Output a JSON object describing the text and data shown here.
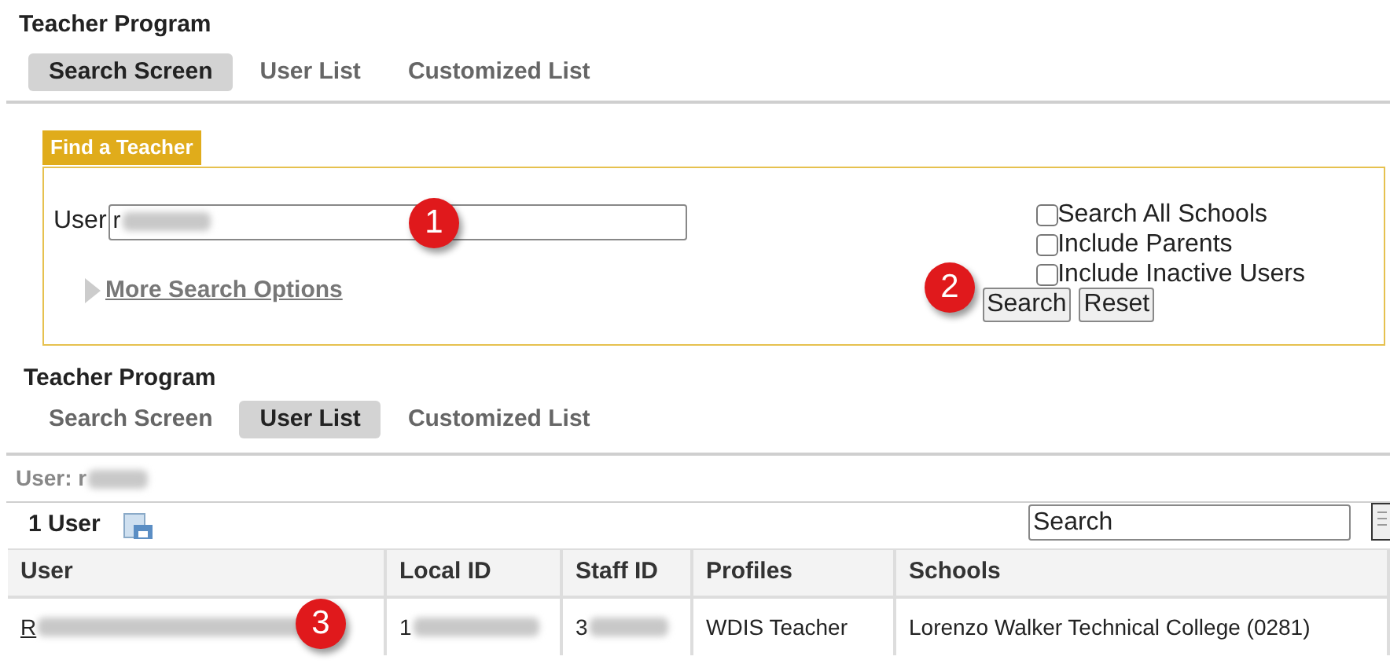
{
  "top_section": {
    "title": "Teacher Program",
    "tabs": [
      {
        "label": "Search Screen",
        "selected": true
      },
      {
        "label": "User List",
        "selected": false
      },
      {
        "label": "Customized List",
        "selected": false
      }
    ]
  },
  "find_panel": {
    "title": "Find a Teacher",
    "user_label": "User",
    "user_value": "r",
    "more_options": "More Search Options",
    "options": [
      {
        "label": "Search All Schools",
        "checked": false
      },
      {
        "label": "Include Parents",
        "checked": false
      },
      {
        "label": "Include Inactive Users",
        "checked": false
      }
    ],
    "buttons": [
      "Search",
      "Reset"
    ]
  },
  "bottom_section": {
    "title": "Teacher Program",
    "tabs": [
      {
        "label": "Search Screen",
        "selected": false
      },
      {
        "label": "User List",
        "selected": true
      },
      {
        "label": "Customized List",
        "selected": false
      }
    ],
    "user_summary": "User: r",
    "count": "1 User",
    "search_value": "Search"
  },
  "table": {
    "columns": [
      "User",
      "Local ID",
      "Staff ID",
      "Profiles",
      "Schools"
    ],
    "rows": [
      [
        "R",
        "1",
        "3",
        "WDIS Teacher",
        "Lorenzo Walker Technical College (0281)"
      ]
    ]
  },
  "callouts": [
    "1",
    "2",
    "3"
  ]
}
